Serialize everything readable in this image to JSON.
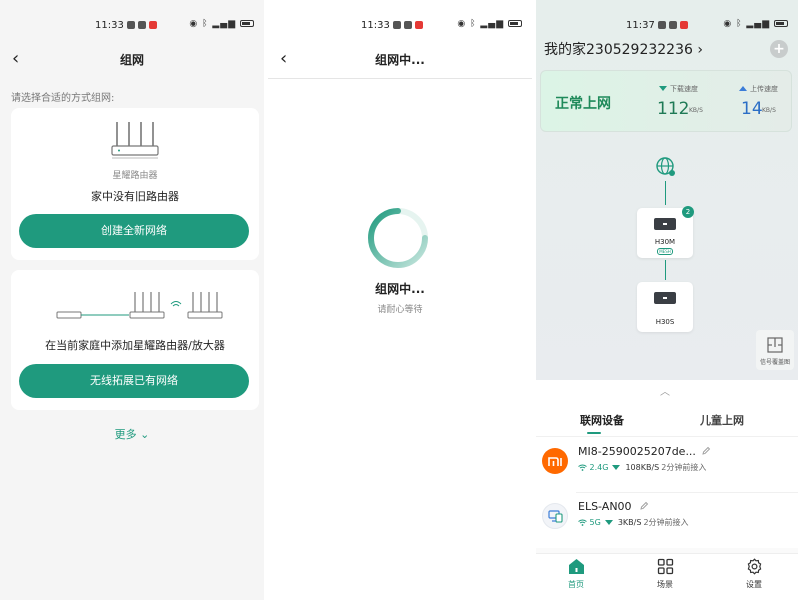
{
  "colors": {
    "accent": "#1f9a7e",
    "online_green": "#1f8a5a",
    "upload_blue": "#3b7dd8",
    "mi_orange": "#ff6900"
  },
  "screen1": {
    "status_time": "11:33",
    "title": "组网",
    "prompt": "请选择合适的方式组网:",
    "card1": {
      "illustration_caption": "星耀路由器",
      "text": "家中没有旧路由器",
      "button": "创建全新网络"
    },
    "card2": {
      "text": "在当前家庭中添加星耀路由器/放大器",
      "button": "无线拓展已有网络"
    },
    "more": "更多"
  },
  "screen2": {
    "status_time": "11:33",
    "title": "组网中...",
    "progress_title": "组网中...",
    "progress_sub": "请耐心等待"
  },
  "screen3": {
    "status_time": "11:37",
    "home_title": "我的家230529232236",
    "status": {
      "online": "正常上网",
      "download_label": "下载速度",
      "download_value": "112",
      "download_unit": "KB/S",
      "upload_label": "上传速度",
      "upload_value": "14",
      "upload_unit": "KB/S"
    },
    "topology": {
      "main_node": "H30M",
      "mesh_tag": "MESH",
      "badge": "2",
      "satellite_node": "H30S"
    },
    "floor_plan": "信号覆盖图",
    "tabs": {
      "devices": "联网设备",
      "kids": "儿童上网"
    },
    "devices": [
      {
        "name": "MI8-2590025207de...",
        "band": "2.4G",
        "rate": "108KB/S",
        "since": "2分钟前接入",
        "icon": "mi-logo-icon"
      },
      {
        "name": "ELS-AN00",
        "band": "5G",
        "rate": "3KB/S",
        "since": "2分钟前接入",
        "icon": "computer-icon"
      }
    ],
    "bottom_nav": {
      "home": "首页",
      "scene": "场景",
      "settings": "设置"
    }
  }
}
